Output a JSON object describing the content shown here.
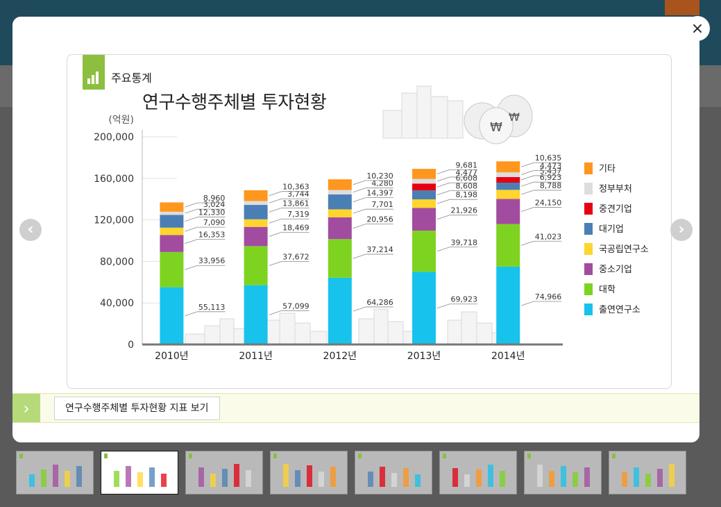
{
  "page": {
    "section_label": "주요통계",
    "title": "연구수행주체별 투자현황",
    "footer_link": "연구수행주체별 투자현황 지표 보기"
  },
  "navigation": {
    "prev": "‹",
    "next": "›",
    "close": "×",
    "footer_chevron": "›"
  },
  "thumbnails": {
    "count": 8,
    "active_index": 1
  },
  "colors": {
    "accent": "#8cbf3f",
    "series": [
      "#17c3ec",
      "#7ed321",
      "#a14c9e",
      "#ffd52e",
      "#4a7fb5",
      "#e60012",
      "#dddddd",
      "#ff961e"
    ]
  },
  "chart_data": {
    "type": "bar",
    "stacked": true,
    "title": "연구수행주체별 투자현황",
    "unit_label": "(억원)",
    "categories": [
      "2010년",
      "2011년",
      "2012년",
      "2013년",
      "2014년"
    ],
    "ylim": [
      0,
      200000
    ],
    "yticks": [
      "0",
      "40,000",
      "80,000",
      "120,000",
      "160,000",
      "200,000"
    ],
    "legend_position": "right",
    "series": [
      {
        "name": "출연연구소",
        "color": "#17c3ec",
        "values": [
          55113,
          57099,
          64286,
          69923,
          74966
        ],
        "labels": [
          "55,113",
          "57,099",
          "64,286",
          "69,923",
          "74,966"
        ]
      },
      {
        "name": "대학",
        "color": "#7ed321",
        "values": [
          33956,
          37672,
          37214,
          39718,
          41023
        ],
        "labels": [
          "33,956",
          "37,672",
          "37,214",
          "39,718",
          "41,023"
        ]
      },
      {
        "name": "중소기업",
        "color": "#a14c9e",
        "values": [
          16353,
          18469,
          20956,
          21926,
          24150
        ],
        "labels": [
          "16,353",
          "18,469",
          "20,956",
          "21,926",
          "24,150"
        ]
      },
      {
        "name": "국공립연구소",
        "color": "#ffd52e",
        "values": [
          7090,
          7319,
          7701,
          8198,
          8788
        ],
        "labels": [
          "7,090",
          "7,319",
          "7,701",
          "8,198",
          "8,788"
        ]
      },
      {
        "name": "대기업",
        "color": "#4a7fb5",
        "values": [
          12330,
          13861,
          14397,
          8608,
          6923
        ],
        "labels": [
          "12,330",
          "13,861",
          "14,397",
          "8,608",
          "6,923"
        ]
      },
      {
        "name": "중견기업",
        "color": "#e60012",
        "values": [
          0,
          0,
          0,
          6608,
          5437
        ],
        "labels": [
          "",
          "",
          "",
          "6,608",
          "5,437"
        ]
      },
      {
        "name": "정부부처",
        "color": "#dddddd",
        "values": [
          3024,
          3744,
          4280,
          4477,
          4473
        ],
        "labels": [
          "3,024",
          "3,744",
          "4,280",
          "4,477",
          "4,473"
        ]
      },
      {
        "name": "기타",
        "color": "#ff961e",
        "values": [
          8960,
          10363,
          10230,
          9681,
          10635
        ],
        "labels": [
          "8,960",
          "10,363",
          "10,230",
          "9,681",
          "10,635"
        ]
      }
    ]
  }
}
